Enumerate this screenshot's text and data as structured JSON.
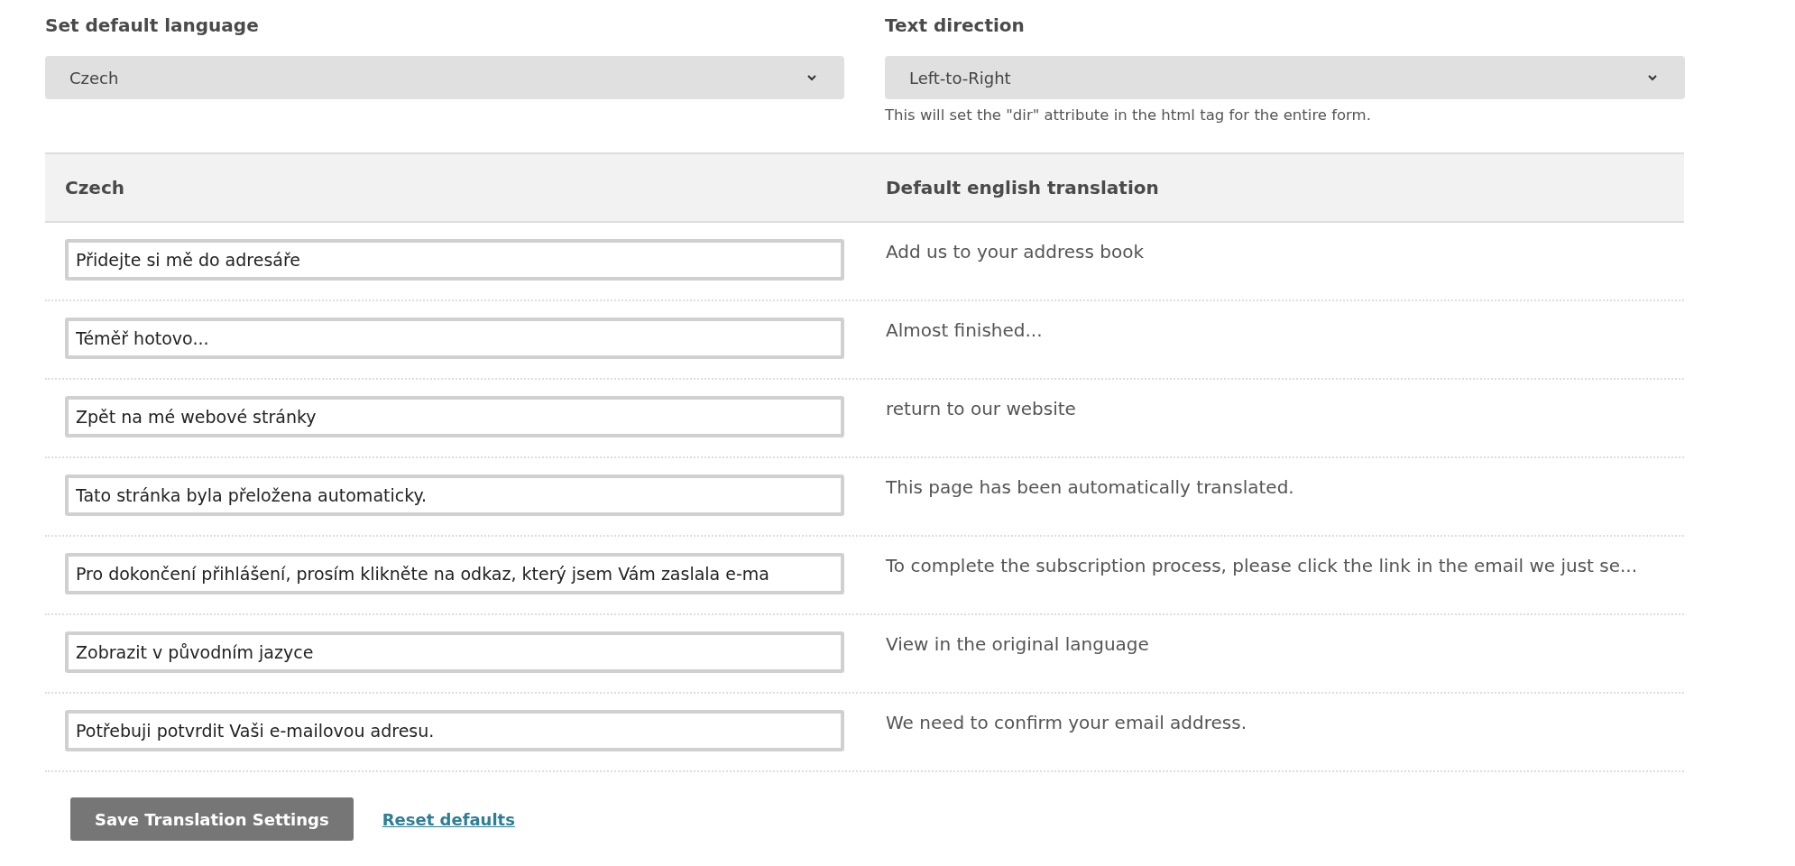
{
  "default_language": {
    "label": "Set default language",
    "value": "Czech"
  },
  "text_direction": {
    "label": "Text direction",
    "value": "Left-to-Right",
    "help": "This will set the \"dir\" attribute in the html tag for the entire form."
  },
  "table": {
    "columns": [
      "Czech",
      "Default english translation"
    ],
    "rows": [
      {
        "translation": "Přidejte si mě do adresáře",
        "default": "Add us to your address book"
      },
      {
        "translation": "Téměř hotovo...",
        "default": "Almost finished..."
      },
      {
        "translation": "Zpět na mé webové stránky",
        "default": "return to our website"
      },
      {
        "translation": "Tato stránka byla přeložena automaticky.",
        "default": "This page has been automatically translated."
      },
      {
        "translation": "Pro dokončení přihlášení, prosím klikněte na odkaz, který jsem Vám zaslala e-ma",
        "default": "To complete the subscription process, please click the link in the email we just se..."
      },
      {
        "translation": "Zobrazit v původním jazyce",
        "default": "View in the original language"
      },
      {
        "translation": "Potřebuji potvrdit Vaši e-mailovou adresu.",
        "default": "We need to confirm your email address."
      }
    ]
  },
  "buttons": {
    "save": "Save Translation Settings",
    "reset": "Reset defaults"
  }
}
